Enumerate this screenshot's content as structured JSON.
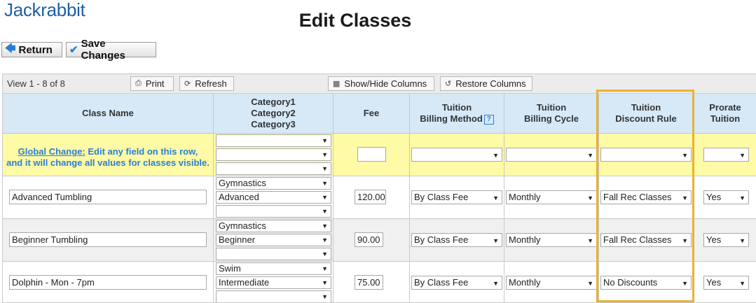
{
  "app": {
    "logo": "Jackrabbit",
    "title": "Edit Classes"
  },
  "buttons": {
    "return": "Return",
    "save": "Save Changes"
  },
  "toolbar": {
    "view": "View 1 - 8 of 8",
    "print": "Print",
    "refresh": "Refresh",
    "show_hide": "Show/Hide Columns",
    "restore": "Restore Columns"
  },
  "columns": {
    "class_name": "Class Name",
    "cat1": "Category1",
    "cat2": "Category2",
    "cat3": "Category3",
    "fee": "Fee",
    "billing_method_1": "Tuition",
    "billing_method_2": "Billing Method",
    "billing_cycle_1": "Tuition",
    "billing_cycle_2": "Billing Cycle",
    "discount_1": "Tuition",
    "discount_2": "Discount Rule",
    "prorate_1": "Prorate",
    "prorate_2": "Tuition",
    "help": "?"
  },
  "global": {
    "link": "Global Change:",
    "line1_rest": " Edit any field on this row,",
    "line2": "and it will change all values for classes visible."
  },
  "rows": [
    {
      "name": "Advanced Tumbling",
      "cat1": "Gymnastics",
      "cat2": "Advanced",
      "cat3": "",
      "fee": "120.00",
      "method": "By Class Fee",
      "cycle": "Monthly",
      "discount": "Fall Rec Classes",
      "prorate": "Yes"
    },
    {
      "name": "Beginner Tumbling",
      "cat1": "Gymnastics",
      "cat2": "Beginner",
      "cat3": "",
      "fee": "90.00",
      "method": "By Class Fee",
      "cycle": "Monthly",
      "discount": "Fall Rec Classes",
      "prorate": "Yes"
    },
    {
      "name": "Dolphin - Mon - 7pm",
      "cat1": "Swim",
      "cat2": "Intermediate",
      "cat3": "",
      "fee": "75.00",
      "method": "By Class Fee",
      "cycle": "Monthly",
      "discount": "No Discounts",
      "prorate": "Yes"
    }
  ],
  "colors": {
    "accent": "#2a7fd4",
    "header_bg": "#d7e9f7",
    "global_bg": "#fffaa6",
    "highlight": "#e8b232"
  }
}
